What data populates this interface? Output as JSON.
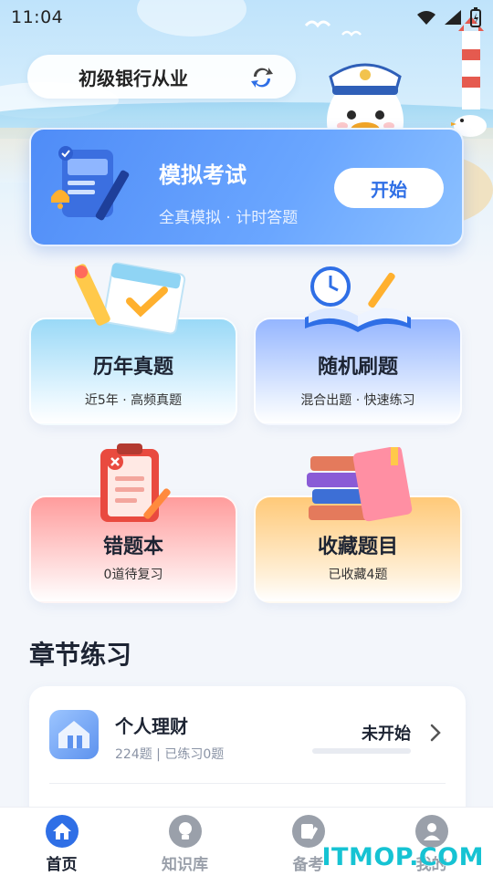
{
  "status_bar": {
    "time": "11:04"
  },
  "header": {
    "bank_label": "初级银行从业"
  },
  "mock_exam": {
    "title": "模拟考试",
    "subtitle": "全真模拟 · 计时答题",
    "start_label": "开始"
  },
  "features": [
    {
      "name": "历年真题",
      "sub": "近5年 · 高频真题",
      "icon": "pencil-calendar-icon"
    },
    {
      "name": "随机刷题",
      "sub": "混合出题 · 快速练习",
      "icon": "clock-book-icon"
    },
    {
      "name": "错题本",
      "sub": "0道待复习",
      "icon": "clipboard-error-icon"
    },
    {
      "name": "收藏题目",
      "sub": "已收藏4题",
      "icon": "books-bookmark-icon"
    }
  ],
  "chapters": {
    "title": "章节练习",
    "items": [
      {
        "name": "个人理财",
        "meta": "224题 | 已练习0题",
        "status": "未开始",
        "progress": 0
      }
    ]
  },
  "bottom_nav": [
    {
      "label": "首页",
      "icon": "home-icon",
      "active": true
    },
    {
      "label": "知识库",
      "icon": "lightbulb-icon",
      "active": false
    },
    {
      "label": "备考",
      "icon": "notebook-pen-icon",
      "active": false
    },
    {
      "label": "我的",
      "icon": "user-icon",
      "active": false
    }
  ],
  "watermark": "ITMOP.COM",
  "colors": {
    "accent": "#2f6fe6",
    "exam_card": "#5a96f9",
    "watermark": "#16c3d3"
  }
}
